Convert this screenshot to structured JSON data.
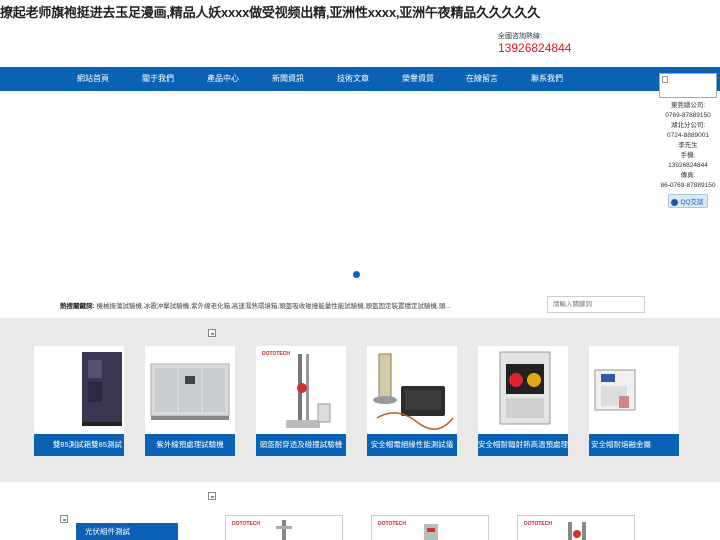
{
  "header": {
    "title": "撩起老师旗袍挺进去玉足漫画,精品人妖xxxx做受视频出精,亚洲性xxxx,亚洲午夜精品久久久久久",
    "hotline_label": "全國咨詢熱線:",
    "hotline_number": "13926824844"
  },
  "nav": {
    "items": [
      "網站首頁",
      "關于我們",
      "產品中心",
      "新聞資訊",
      "技術文章",
      "榮譽資質",
      "在線留言",
      "聯系我們"
    ]
  },
  "side_panel": {
    "lines": [
      "東莞總公司:",
      "0769-87889150",
      "湖北分公司:",
      "0724-8889001",
      "李先生",
      "手機:",
      "13926824844",
      "傳真:",
      "86-0769-87889150"
    ],
    "qq_label": "QQ交談"
  },
  "hot": {
    "label": "熱搜關鍵詞:",
    "keywords": "機械振蕩試驗機,冰雹沖擊試驗機,紫外線老化箱,高速濕熱環境箱,頭盔吸收碰撞能量性能試驗機,頭盔固定裝置穩定試驗機,頭..."
  },
  "search": {
    "placeholder": "請輸入關鍵詞"
  },
  "products": [
    {
      "name": "雙85測試箱雙85測試"
    },
    {
      "name": "紫外線預處理試驗機"
    },
    {
      "name": "頭盔耐穿透及碰撞試驗機"
    },
    {
      "name": "安全帽電絕緣性能測試儀"
    },
    {
      "name": "安全帽耐輻射熱高溫預處理試"
    },
    {
      "name": "安全帽耐熔融金屬"
    }
  ],
  "bottom": {
    "category_label": "光伏組件測試",
    "thumb_logo": "DOTOTECH"
  },
  "colors": {
    "brand_blue": "#0b62b5",
    "hotline_red": "#e4141b",
    "band_gray": "#e9e9e9"
  }
}
